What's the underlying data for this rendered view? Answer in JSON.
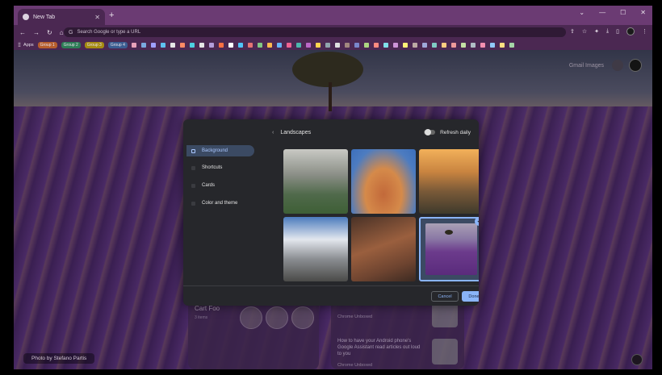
{
  "browser": {
    "tab_title": "New Tab",
    "omnibox_placeholder": "Search Google or type a URL",
    "new_tab_symbol": "+",
    "window_controls": [
      "⌄",
      "—",
      "☐",
      "✕"
    ]
  },
  "bookmarks": {
    "apps_label": "Apps",
    "groups": [
      "Group 1",
      "Group 2",
      "Group 3",
      "Group 4"
    ],
    "bookmark_colors": [
      "#e8a1b9",
      "#7aa9e0",
      "#9fa0ff",
      "#5ec1f0",
      "#e6e6e6",
      "#ff8a65",
      "#4dd0e1",
      "#e6e6e6",
      "#b39ddb",
      "#ff7043",
      "#ffffff",
      "#4fc3f7",
      "#e57373",
      "#81c784",
      "#ffb74d",
      "#64b5f6",
      "#f06292",
      "#4db6ac",
      "#ba68c8",
      "#ffd54f",
      "#90a4ae",
      "#e0e0e0",
      "#a1887f",
      "#7986cb",
      "#aed581",
      "#ff8a80",
      "#80deea",
      "#ce93d8",
      "#fff176",
      "#bcaaa4",
      "#9fa8da",
      "#80cbc4",
      "#ffcc80",
      "#ef9a9a",
      "#c5e1a5",
      "#b0bec5",
      "#f48fb1",
      "#90caf9",
      "#ffe082",
      "#a5d6a7"
    ]
  },
  "ntp": {
    "gmail_images": "Gmail  Images",
    "cart_title": "Cart Foo",
    "cart_sub": "3 items",
    "chrome_unboxed_1": "Chrome Unboxed",
    "article_title": "How to have your Android phone's Google Assistant read articles out loud to you",
    "chrome_unboxed_2": "Chrome Unboxed",
    "photo_credit": "Photo by Stefano Partis"
  },
  "dialog": {
    "sidebar": [
      {
        "label": "Background",
        "active": true
      },
      {
        "label": "Shortcuts",
        "active": false
      },
      {
        "label": "Cards",
        "active": false
      },
      {
        "label": "Color and theme",
        "active": false
      }
    ],
    "header_title": "Landscapes",
    "refresh_label": "Refresh daily",
    "tiles": [
      "rocky-lake",
      "desert-arch",
      "canyon-sunset",
      "snow-mountain",
      "red-canyon-road",
      "lavender-field"
    ],
    "selected_tile": "lavender-field",
    "cancel_label": "Cancel",
    "done_label": "Done"
  },
  "colors": {
    "accent": "#8ab4f8",
    "titlebar": "#6b3b73",
    "toolbar": "#4b2852",
    "dialog_bg": "#26272b"
  }
}
